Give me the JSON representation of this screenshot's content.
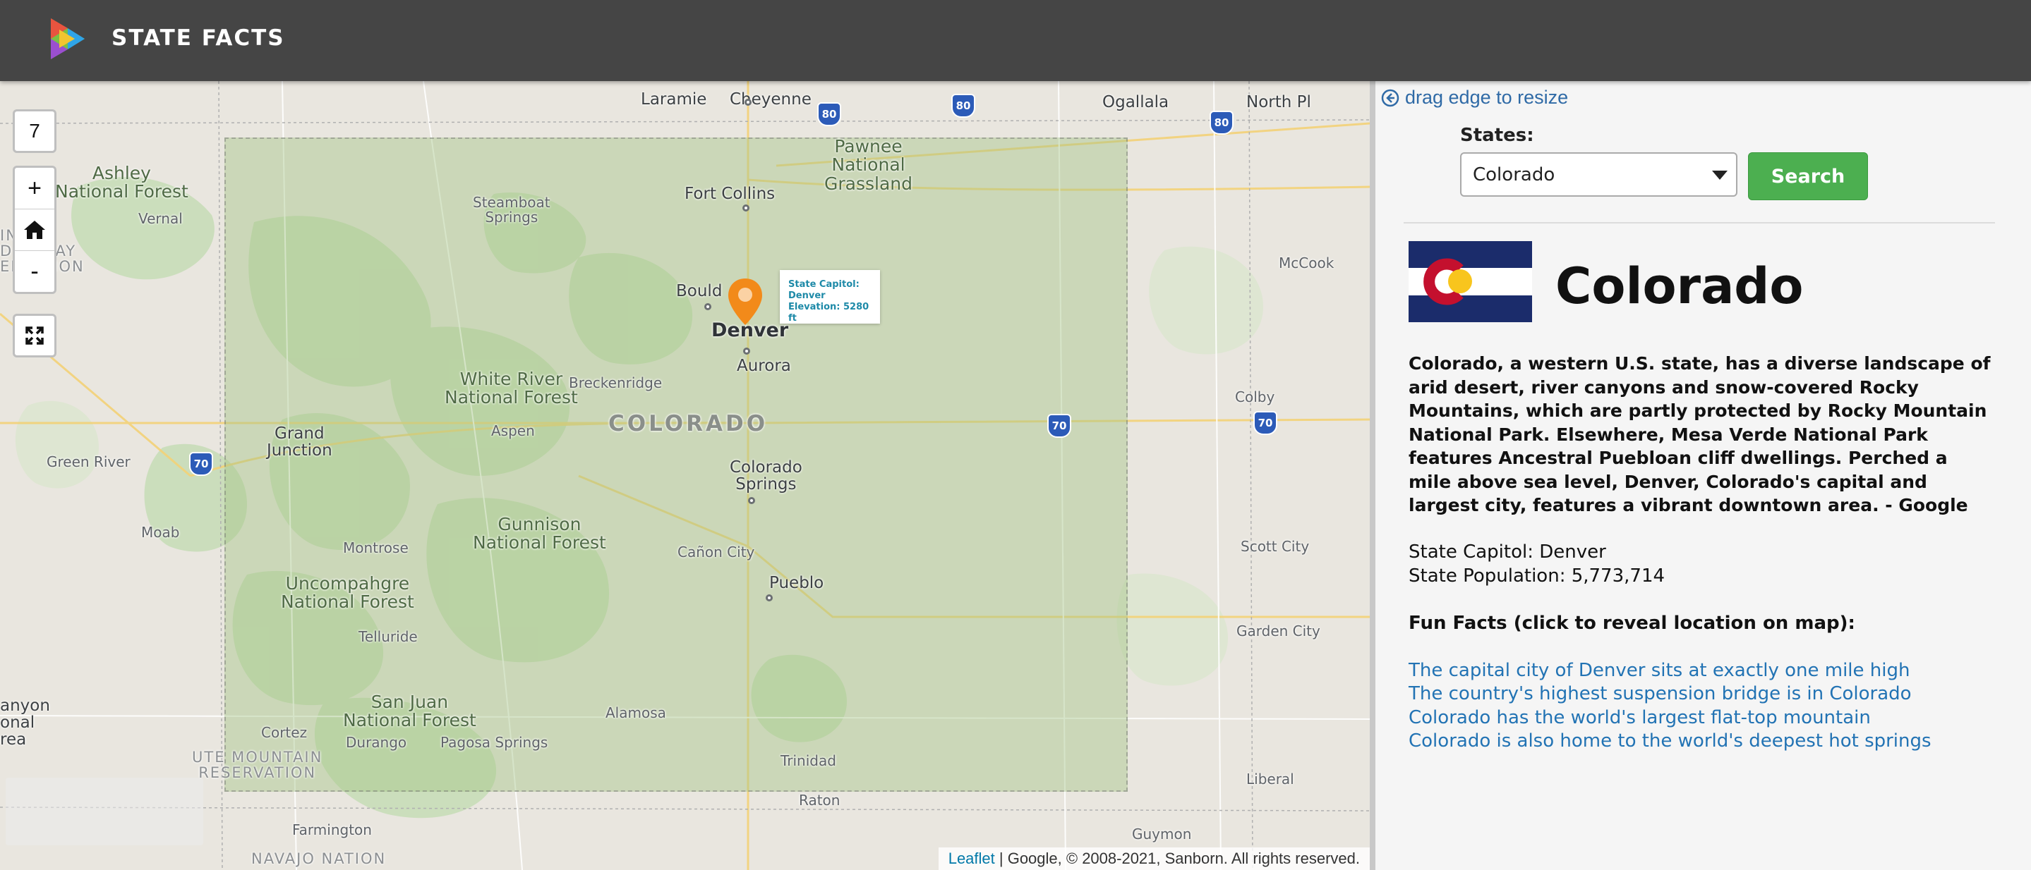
{
  "header": {
    "title": "STATE FACTS"
  },
  "map": {
    "zoom_level": "7",
    "controls": {
      "zoom_in": "+",
      "zoom_out": "-"
    },
    "labels": {
      "laramie": "Laramie",
      "cheyenne": "Cheyenne",
      "ogallala": "Ogallala",
      "north_platte": "North Pl",
      "pawnee": "Pawnee\nNational\nGrassland",
      "ashley": "Ashley\nNational Forest",
      "vernal": "Vernal",
      "uintah": "INTAH\nD OURAY\nERVATION",
      "steamboat": "Steamboat\nSprings",
      "fort_collins": "Fort Collins",
      "boulder": "Bould",
      "denver": "Denver",
      "aurora": "Aurora",
      "white_river": "White River\nNational Forest",
      "breckenridge": "Breckenridge",
      "colorado_label": "COLORADO",
      "grand_junction": "Grand\nJunction",
      "aspen": "Aspen",
      "green_river": "Green River",
      "colorado_springs": "Colorado\nSprings",
      "gunnison": "Gunnison\nNational Forest",
      "montrose": "Montrose",
      "moab": "Moab",
      "canon_city": "Cañon City",
      "pueblo": "Pueblo",
      "uncompahgre": "Uncompahgre\nNational Forest",
      "telluride": "Telluride",
      "san_juan": "San Juan\nNational Forest",
      "durango": "Durango",
      "pagosa": "Pagosa Springs",
      "alamosa": "Alamosa",
      "cortez": "Cortez",
      "trinidad": "Trinidad",
      "ute_mountain": "UTE MOUNTAIN\nRESERVATION",
      "canyon": "anyon\nonal\nrea",
      "farmington": "Farmington",
      "navajo": "NAVAJO NATION",
      "raton": "Raton",
      "mccook": "McCook",
      "colby": "Colby",
      "scott_city": "Scott City",
      "garden_city": "Garden City",
      "liberal": "Liberal",
      "guymon": "Guymon"
    },
    "highways": [
      "80",
      "80",
      "80",
      "70",
      "70",
      "70"
    ],
    "popup": {
      "line1": "State Capitol:",
      "line2": "Denver",
      "line3": "Elevation: 5280 ft"
    },
    "attribution": {
      "link": "Leaflet",
      "text": " | Google, © 2008-2021, Sanborn. All rights reserved."
    }
  },
  "sidebar": {
    "resize_hint": "drag edge to resize",
    "states_label": "States:",
    "selected_state": "Colorado",
    "search_label": "Search",
    "state_name": "Colorado",
    "description": "Colorado, a western U.S. state, has a diverse landscape of arid desert, river canyons and snow-covered Rocky Mountains, which are partly protected by Rocky Mountain National Park. Elsewhere, Mesa Verde National Park features Ancestral Puebloan cliff dwellings. Perched a mile above sea level, Denver, Colorado's capital and largest city, features a vibrant downtown area. - Google",
    "capitol": "State Capitol: Denver",
    "population": "State Population: 5,773,714",
    "fun_facts_heading": "Fun Facts (click to reveal location on map):",
    "fun_facts": [
      "The capital city of Denver sits at exactly one mile high",
      "The country's highest suspension bridge is in Colorado",
      "Colorado has the world's largest flat-top mountain",
      "Colorado is also home to the world's deepest hot springs"
    ]
  },
  "colors": {
    "header_bg": "#454545",
    "search_button": "#4caf50",
    "link": "#2273b4",
    "marker": "#f28a1a",
    "state_overlay": "#a3c484"
  }
}
